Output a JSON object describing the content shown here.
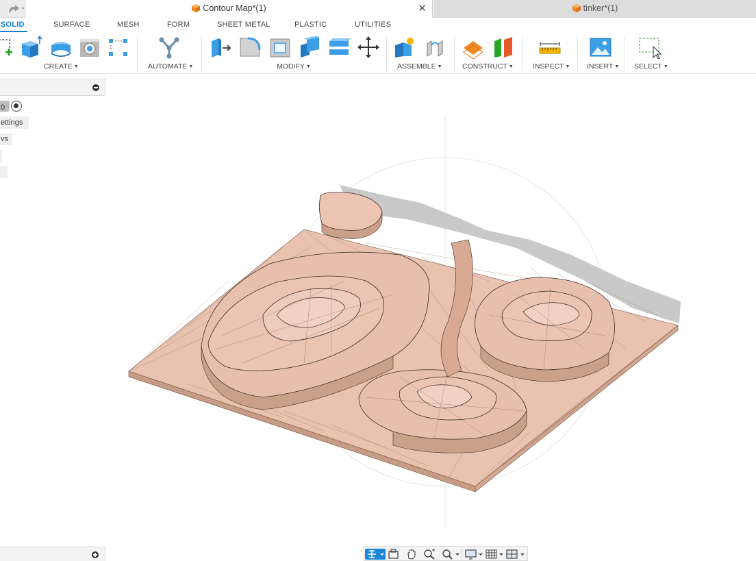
{
  "tabs": {
    "active_doc": "Contour Map*(1)",
    "other_doc": "tinker*(1)",
    "close_glyph": "✕"
  },
  "ribbon": {
    "tabs": [
      "SOLID",
      "SURFACE",
      "MESH",
      "FORM",
      "SHEET METAL",
      "PLASTIC",
      "UTILITIES"
    ],
    "active_tab": "SOLID",
    "groups": [
      "CREATE",
      "AUTOMATE",
      "MODIFY",
      "ASSEMBLE",
      "CONSTRUCT",
      "INSPECT",
      "INSERT",
      "SELECT"
    ],
    "caret": "▼"
  },
  "browser": {
    "item_1": "0",
    "item_2": "ettings",
    "item_3": "vs"
  },
  "colors": {
    "accent": "#0a7fd0",
    "mesh_fill": "#eac2b0",
    "mesh_shade": "#d9a993",
    "shadow": "#c9c9c9"
  },
  "icons": {
    "redo": "redo-icon",
    "document": "cube-document-icon",
    "orbit": "orbit-icon",
    "look_at": "look-at-icon",
    "pan": "pan-icon",
    "zoom": "zoom-icon",
    "fit": "fit-icon",
    "display": "display-settings-icon",
    "grid": "grid-settings-icon",
    "viewports": "viewports-icon"
  }
}
